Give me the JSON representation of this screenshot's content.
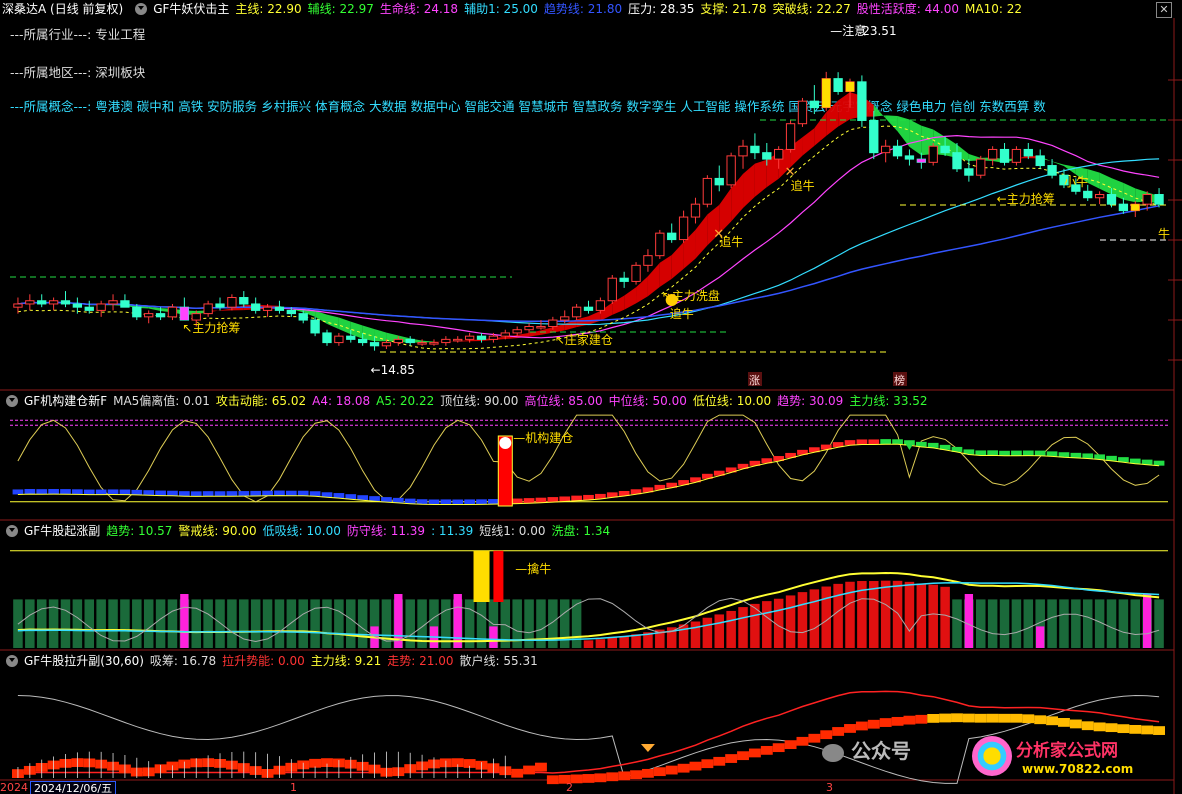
{
  "header": {
    "title": "深桑达A (日线 前复权)",
    "indicator": "GF牛妖伏击主",
    "items": [
      {
        "label": "主线: 22.90",
        "color": "#ffff33"
      },
      {
        "label": "辅线: 22.97",
        "color": "#33ff33"
      },
      {
        "label": "生命线: 24.18",
        "color": "#ff44ff"
      },
      {
        "label": "辅助1: 25.00",
        "color": "#33ddff"
      },
      {
        "label": "趋势线: 21.80",
        "color": "#3355ff"
      },
      {
        "label": "压力: 28.35",
        "color": "#ffffff"
      },
      {
        "label": "支撑: 21.78",
        "color": "#ffff33"
      },
      {
        "label": "突破线: 22.27",
        "color": "#ffff33"
      },
      {
        "label": "股性活跃度: 44.00",
        "color": "#ff44ff"
      },
      {
        "label": "MA10: 22",
        "color": "#ffff33"
      }
    ]
  },
  "info_lines": [
    {
      "text": "---所属行业---: 专业工程",
      "color": "#dddddd"
    },
    {
      "text": "---所属地区---: 深圳板块",
      "color": "#dddddd"
    },
    {
      "text": "---所属概念---: 粤港澳 碳中和 高铁 安防服务 乡村振兴 体育概念 大数据 数据中心 智能交通 智慧城市 智慧政务 数字孪生 人工智能 操作系统 国资云 元宇宙概念 绿色电力 信创 东数西算 数",
      "color": "#33ddff"
    }
  ],
  "annotations": {
    "high": "23.51",
    "high_prefix": "注意",
    "low": "14.85",
    "zhuli_qiangchou_1": "主力抢筹",
    "zhuli_qiangchou_2": "主力抢筹",
    "zhuangjia_jiancang": "庄家建仓",
    "zhuli_xipan": "主力洗盘",
    "zhui_niu_1": "追牛",
    "zhui_niu_2": "追牛",
    "zhui_niu_3": "追牛",
    "xiao_niu": "小牛",
    "niu": "牛",
    "zhang": "涨",
    "bang": "榜"
  },
  "pane2": {
    "name": "GF机构建仓新F",
    "items": [
      {
        "label": "MA5偏离值: 0.01",
        "color": "#dddddd"
      },
      {
        "label": "攻击动能: 65.02",
        "color": "#ffff33"
      },
      {
        "label": "A4: 18.08",
        "color": "#ff44ff"
      },
      {
        "label": "A5: 20.22",
        "color": "#33ff33"
      },
      {
        "label": "顶位线: 90.00",
        "color": "#dddddd"
      },
      {
        "label": "高位线: 85.00",
        "color": "#ff44ff"
      },
      {
        "label": "中位线: 50.00",
        "color": "#ff44ff"
      },
      {
        "label": "低位线: 10.00",
        "color": "#ffff33"
      },
      {
        "label": "趋势: 30.09",
        "color": "#ff44ff"
      },
      {
        "label": "主力线: 33.52",
        "color": "#33ff33"
      }
    ],
    "tag": "机构建仓"
  },
  "pane3": {
    "name": "GF牛股起涨副",
    "items": [
      {
        "label": "趋势: 10.57",
        "color": "#33ff33"
      },
      {
        "label": "警戒线: 90.00",
        "color": "#ffff33"
      },
      {
        "label": "低吸线: 10.00",
        "color": "#33ddff"
      },
      {
        "label": "防守线: 11.39",
        "color": "#ff44ff"
      },
      {
        "label": ": 11.39",
        "color": "#33ddff"
      },
      {
        "label": "短线1: 0.00",
        "color": "#dddddd"
      },
      {
        "label": "洗盘: 1.34",
        "color": "#33ff33"
      }
    ],
    "tag": "擒牛"
  },
  "pane4": {
    "name": "GF牛股拉升副(30,60)",
    "items": [
      {
        "label": "吸筹: 16.78",
        "color": "#dddddd"
      },
      {
        "label": "拉升势能: 0.00",
        "color": "#ff3333"
      },
      {
        "label": "主力线: 9.21",
        "color": "#ffff33"
      },
      {
        "label": "走势: 21.00",
        "color": "#ff3333"
      },
      {
        "label": "散户线: 55.31",
        "color": "#dddddd"
      }
    ]
  },
  "footer": {
    "date": "2024/12/06/五",
    "year": "2024",
    "months": [
      "1",
      "2",
      "3"
    ]
  },
  "watermark": {
    "gzh": "公众号",
    "site": "分析家公式网",
    "url": "www.70822.com"
  },
  "chart_data": {
    "type": "candlestick",
    "price_range": [
      14.0,
      24.5
    ],
    "high": 23.51,
    "low": 14.85,
    "candles": [
      [
        16.2,
        16.5,
        16.0,
        16.3
      ],
      [
        16.3,
        16.6,
        16.1,
        16.4
      ],
      [
        16.4,
        16.6,
        16.2,
        16.3
      ],
      [
        16.3,
        16.5,
        16.1,
        16.4
      ],
      [
        16.4,
        16.7,
        16.2,
        16.3
      ],
      [
        16.3,
        16.5,
        16.0,
        16.2
      ],
      [
        16.2,
        16.4,
        16.0,
        16.1
      ],
      [
        16.1,
        16.4,
        15.9,
        16.3
      ],
      [
        16.3,
        16.6,
        16.1,
        16.4
      ],
      [
        16.4,
        16.6,
        16.2,
        16.2
      ],
      [
        16.2,
        16.3,
        15.8,
        15.9
      ],
      [
        15.9,
        16.1,
        15.7,
        16.0
      ],
      [
        16.0,
        16.2,
        15.8,
        15.9
      ],
      [
        15.9,
        16.3,
        15.8,
        16.2
      ],
      [
        16.2,
        16.5,
        16.0,
        15.8
      ],
      [
        15.8,
        16.1,
        15.6,
        16.0
      ],
      [
        16.0,
        16.4,
        15.9,
        16.3
      ],
      [
        16.3,
        16.5,
        16.1,
        16.2
      ],
      [
        16.2,
        16.6,
        16.1,
        16.5
      ],
      [
        16.5,
        16.7,
        16.2,
        16.3
      ],
      [
        16.3,
        16.5,
        16.0,
        16.1
      ],
      [
        16.1,
        16.3,
        15.9,
        16.2
      ],
      [
        16.2,
        16.4,
        16.0,
        16.1
      ],
      [
        16.1,
        16.2,
        15.9,
        16.0
      ],
      [
        16.0,
        16.1,
        15.7,
        15.8
      ],
      [
        15.8,
        15.9,
        15.3,
        15.4
      ],
      [
        15.4,
        15.5,
        15.0,
        15.1
      ],
      [
        15.1,
        15.4,
        15.0,
        15.3
      ],
      [
        15.3,
        15.5,
        15.1,
        15.2
      ],
      [
        15.2,
        15.4,
        15.0,
        15.1
      ],
      [
        15.1,
        15.3,
        14.85,
        15.0
      ],
      [
        15.0,
        15.2,
        14.9,
        15.1
      ],
      [
        15.1,
        15.3,
        15.0,
        15.2
      ],
      [
        15.2,
        15.3,
        15.0,
        15.1
      ],
      [
        15.1,
        15.2,
        15.0,
        15.1
      ],
      [
        15.1,
        15.2,
        15.0,
        15.1
      ],
      [
        15.1,
        15.3,
        15.0,
        15.2
      ],
      [
        15.2,
        15.3,
        15.1,
        15.2
      ],
      [
        15.2,
        15.4,
        15.1,
        15.3
      ],
      [
        15.3,
        15.4,
        15.1,
        15.2
      ],
      [
        15.2,
        15.4,
        15.1,
        15.3
      ],
      [
        15.3,
        15.5,
        15.2,
        15.4
      ],
      [
        15.4,
        15.6,
        15.3,
        15.5
      ],
      [
        15.5,
        15.7,
        15.4,
        15.6
      ],
      [
        15.6,
        15.8,
        15.5,
        15.6
      ],
      [
        15.6,
        15.9,
        15.5,
        15.8
      ],
      [
        15.8,
        16.1,
        15.7,
        15.9
      ],
      [
        15.9,
        16.3,
        15.8,
        16.2
      ],
      [
        16.2,
        16.4,
        16.0,
        16.1
      ],
      [
        16.1,
        16.5,
        16.0,
        16.4
      ],
      [
        16.4,
        17.2,
        16.3,
        17.1
      ],
      [
        17.1,
        17.3,
        16.8,
        17.0
      ],
      [
        17.0,
        17.6,
        16.9,
        17.5
      ],
      [
        17.5,
        18.0,
        17.3,
        17.8
      ],
      [
        17.8,
        18.6,
        17.7,
        18.5
      ],
      [
        18.5,
        18.8,
        18.2,
        18.3
      ],
      [
        18.3,
        19.2,
        18.2,
        19.0
      ],
      [
        19.0,
        19.6,
        18.8,
        19.4
      ],
      [
        19.4,
        20.3,
        19.3,
        20.2
      ],
      [
        20.2,
        20.6,
        19.8,
        20.0
      ],
      [
        20.0,
        21.0,
        19.9,
        20.9
      ],
      [
        20.9,
        21.4,
        20.5,
        21.2
      ],
      [
        21.2,
        21.6,
        20.8,
        21.0
      ],
      [
        21.0,
        21.3,
        20.6,
        20.8
      ],
      [
        20.8,
        21.2,
        20.5,
        21.1
      ],
      [
        21.1,
        22.0,
        21.0,
        21.9
      ],
      [
        21.9,
        22.7,
        21.8,
        22.6
      ],
      [
        22.6,
        23.1,
        22.2,
        22.4
      ],
      [
        22.4,
        23.51,
        22.3,
        23.3
      ],
      [
        23.3,
        23.5,
        22.8,
        22.9
      ],
      [
        22.9,
        23.3,
        22.4,
        23.2
      ],
      [
        23.2,
        23.4,
        21.8,
        22.0
      ],
      [
        22.0,
        22.3,
        20.8,
        21.0
      ],
      [
        21.0,
        21.4,
        20.7,
        21.2
      ],
      [
        21.2,
        21.4,
        20.8,
        20.9
      ],
      [
        20.9,
        21.1,
        20.6,
        20.8
      ],
      [
        20.8,
        21.0,
        20.5,
        20.7
      ],
      [
        20.7,
        21.3,
        20.6,
        21.2
      ],
      [
        21.2,
        21.5,
        20.9,
        21.0
      ],
      [
        21.0,
        21.3,
        20.4,
        20.5
      ],
      [
        20.5,
        20.8,
        20.1,
        20.3
      ],
      [
        20.3,
        20.9,
        20.2,
        20.8
      ],
      [
        20.8,
        21.2,
        20.6,
        21.1
      ],
      [
        21.1,
        21.3,
        20.6,
        20.7
      ],
      [
        20.7,
        21.2,
        20.6,
        21.1
      ],
      [
        21.1,
        21.3,
        20.8,
        20.9
      ],
      [
        20.9,
        21.1,
        20.5,
        20.6
      ],
      [
        20.6,
        20.8,
        20.2,
        20.3
      ],
      [
        20.3,
        20.5,
        19.9,
        20.0
      ],
      [
        20.0,
        20.2,
        19.7,
        19.8
      ],
      [
        19.8,
        20.0,
        19.5,
        19.6
      ],
      [
        19.6,
        19.8,
        19.4,
        19.7
      ],
      [
        19.7,
        19.9,
        19.3,
        19.4
      ],
      [
        19.4,
        19.6,
        19.1,
        19.2
      ],
      [
        19.2,
        19.5,
        19.0,
        19.4
      ],
      [
        19.4,
        19.8,
        19.2,
        19.7
      ],
      [
        19.7,
        19.9,
        19.3,
        19.4
      ]
    ]
  }
}
